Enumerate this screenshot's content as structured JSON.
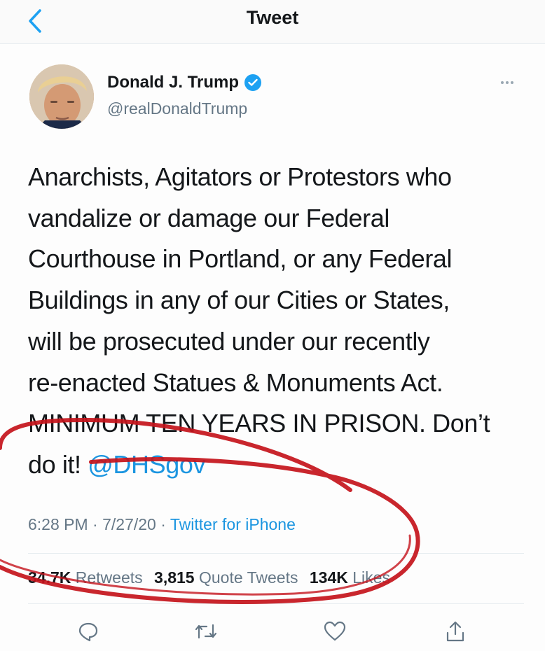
{
  "header": {
    "title": "Tweet",
    "back_icon": "chevron-left-icon"
  },
  "author": {
    "name": "Donald J. Trump",
    "handle": "@realDonaldTrump",
    "verified": true
  },
  "tweet": {
    "lines": [
      "Anarchists, Agitators or Protestors who",
      "vandalize or damage our Federal",
      "Courthouse in Portland, or any Federal",
      "Buildings in any of our Cities or States,",
      "will be prosecuted under our recently",
      "re-enacted Statues & Monuments Act.",
      "MINIMUM TEN YEARS IN PRISON. Don’t"
    ],
    "last_line_text": "do it! ",
    "mention": "@DHSgov"
  },
  "meta": {
    "time": "6:28 PM",
    "date": "7/27/20",
    "separator": " · ",
    "source": "Twitter for iPhone"
  },
  "stats": {
    "retweets_count": "34.7K",
    "retweets_label": "Retweets",
    "quote_count": "3,815",
    "quote_label": "Quote Tweets",
    "likes_count": "134K",
    "likes_label": "Likes"
  },
  "actions": [
    "reply-icon",
    "retweet-icon",
    "like-icon",
    "share-icon"
  ],
  "colors": {
    "accent": "#1b95e0",
    "verified": "#1da1f2",
    "secondary_text": "#657786",
    "annotation_red": "#c4131b"
  }
}
